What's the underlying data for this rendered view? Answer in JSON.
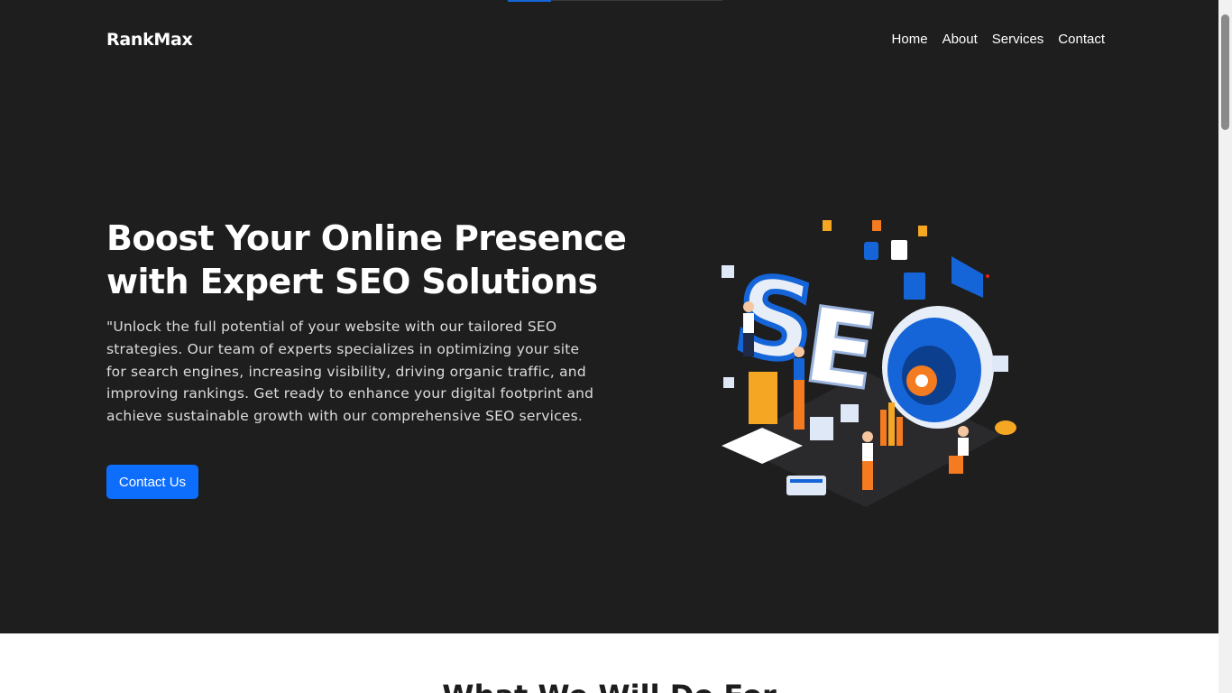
{
  "brand": {
    "name": "RankMax"
  },
  "nav": {
    "items": [
      "Home",
      "About",
      "Services",
      "Contact"
    ]
  },
  "hero": {
    "headline": "Boost Your Online Presence with Expert SEO Solutions",
    "description": "\"Unlock the full potential of your website with our tailored SEO strategies. Our team of experts specializes in optimizing your site for search engines, increasing visibility, driving organic traffic, and improving rankings. Get ready to enhance your digital footprint and achieve sustainable growth with our comprehensive SEO services.",
    "cta_label": "Contact Us",
    "illustration_text": "SEO"
  },
  "next_section": {
    "title": "What We Will Do For"
  },
  "colors": {
    "hero_bg": "#1e1e1f",
    "accent": "#0d6efd",
    "illus_blue": "#1565d8",
    "illus_orange": "#f47b20"
  }
}
